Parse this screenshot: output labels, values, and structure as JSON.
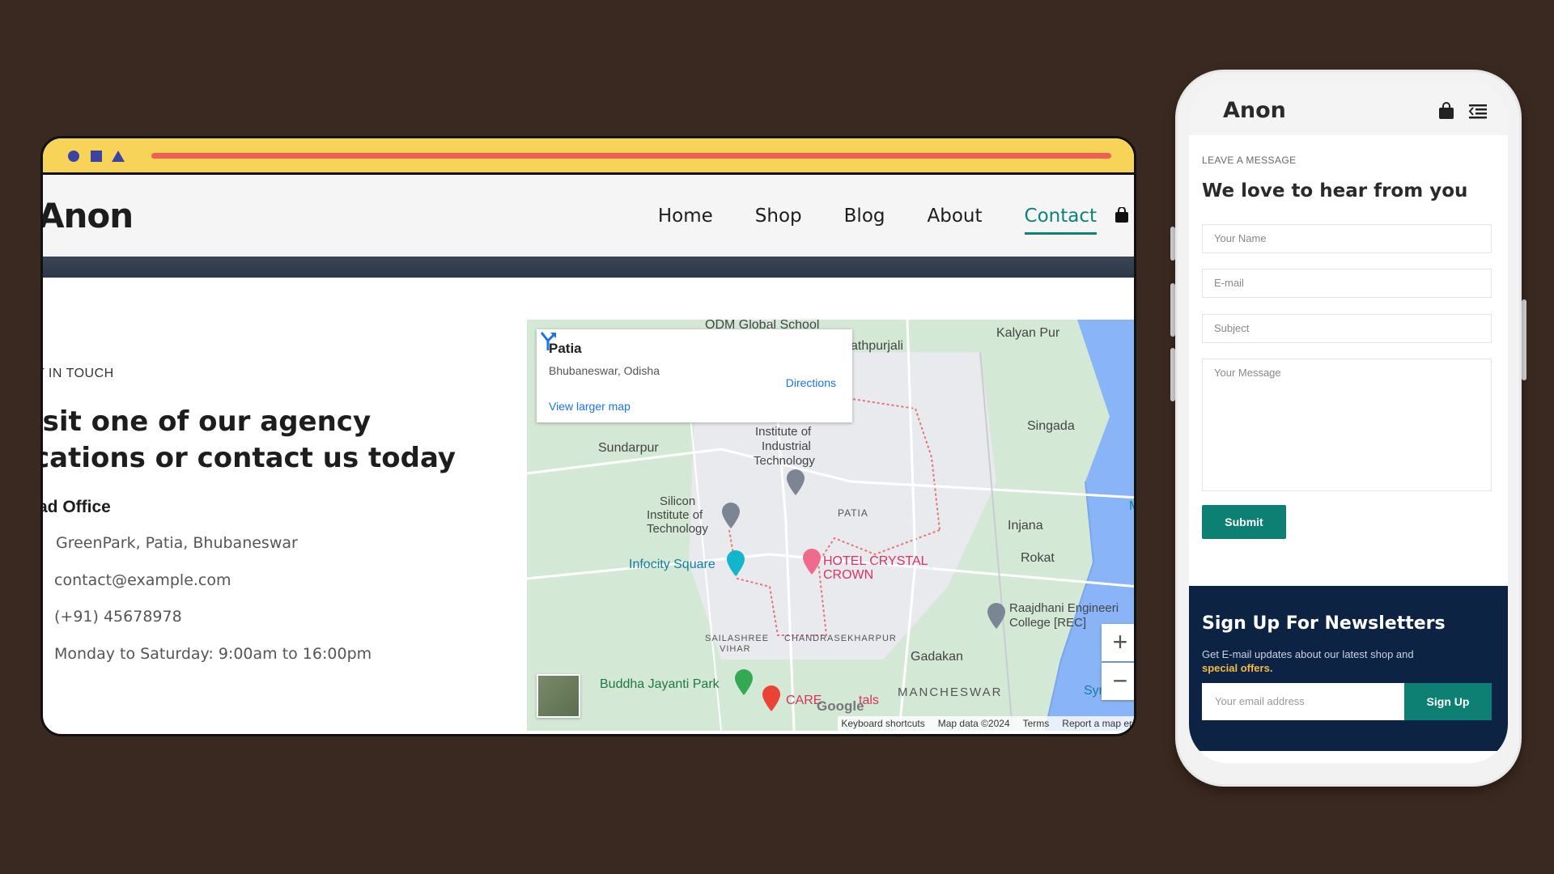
{
  "desktop": {
    "brand": "Anon",
    "nav": [
      {
        "label": "Home"
      },
      {
        "label": "Shop"
      },
      {
        "label": "Blog"
      },
      {
        "label": "About"
      },
      {
        "label": "Contact",
        "active": true
      }
    ],
    "contact": {
      "eyebrow": "T IN TOUCH",
      "headline_line1": "isit one of our agency",
      "headline_line2": "cations or contact us today",
      "office_title": "ad Office",
      "address": "GreenPark, Patia, Bhubaneswar",
      "email": "contact@example.com",
      "phone": "(+91) 45678978",
      "hours": "Monday to Saturday: 9:00am to 16:00pm"
    },
    "map": {
      "place": "Patia",
      "region": "Bhubaneswar, Odisha",
      "directions": "Directions",
      "view_larger": "View larger map",
      "labels": {
        "odm": "ODM Global School",
        "kalyan": "Kalyan Pur",
        "raghunath": "athpurjali",
        "sundarpur": "Sundarpur",
        "iit1": "Institute of",
        "iit2": "Industrial",
        "iit3": "Technology",
        "singada": "Singada",
        "silicon1": "Silicon",
        "silicon2": "Institute of",
        "silicon3": "Technology",
        "patia": "PATIA",
        "injana": "Injana",
        "infocity": "Infocity Square",
        "hotel1": "HOTEL CRYSTAL",
        "hotel2": "CROWN",
        "rokat": "Rokat",
        "raaj1": "Raajdhani Engineeri",
        "raaj2": "College [REC]",
        "sailashree1": "SAILASHREE",
        "sailashree2": "VIHAR",
        "chandra": "CHANDRASEKHARPUR",
        "gadakan": "Gadakan",
        "buddha": "Buddha Jayanti Park",
        "care": "CARE",
        "hospitals": "tals",
        "mancheswar": "MANCHESWAR",
        "sym": "Sym",
        "m": "M"
      },
      "google": "Google",
      "footer": [
        "Keyboard shortcuts",
        "Map data ©2024",
        "Terms",
        "Report a map err"
      ],
      "zoom_in": "+",
      "zoom_out": "−"
    }
  },
  "mobile": {
    "brand": "Anon",
    "eyebrow": "LEAVE A MESSAGE",
    "title": "We love to hear from you",
    "fields": {
      "name": "Your Name",
      "email": "E-mail",
      "subject": "Subject",
      "message": "Your Message"
    },
    "submit": "Submit",
    "newsletter": {
      "title": "Sign Up For Newsletters",
      "text_prefix": "Get E-mail updates about our latest shop and",
      "text_highlight": "special offers.",
      "email_placeholder": "Your email address",
      "button": "Sign Up"
    }
  },
  "colors": {
    "background": "#3a2920",
    "browser_bar": "#f7d358",
    "accent_line": "#ef5f55",
    "teal": "#0d7f73",
    "navy": "#0d2344",
    "dots": "#3b43a3"
  }
}
